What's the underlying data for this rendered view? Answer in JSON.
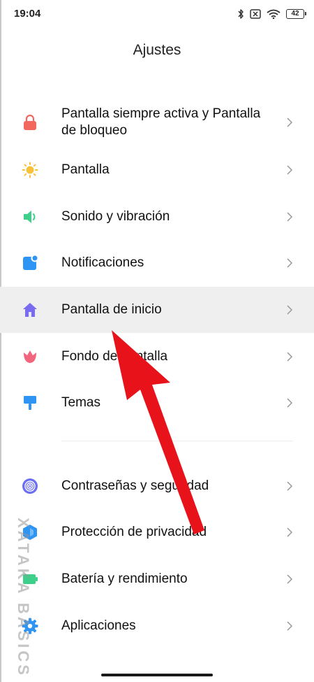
{
  "status_bar": {
    "time": "19:04",
    "battery": "42"
  },
  "header": {
    "title": "Ajustes"
  },
  "settings": {
    "group1": [
      {
        "label": "Pantalla siempre activa y Pantalla de bloqueo",
        "icon": "lock-icon"
      },
      {
        "label": "Pantalla",
        "icon": "sun-icon"
      },
      {
        "label": "Sonido y vibración",
        "icon": "speaker-icon"
      },
      {
        "label": "Notificaciones",
        "icon": "notification-icon"
      },
      {
        "label": "Pantalla de inicio",
        "icon": "home-icon"
      },
      {
        "label": "Fondo de pantalla",
        "icon": "tulip-icon"
      },
      {
        "label": "Temas",
        "icon": "paintbrush-icon"
      }
    ],
    "group2": [
      {
        "label": "Contraseñas y seguridad",
        "icon": "fingerprint-icon"
      },
      {
        "label": "Protección de privacidad",
        "icon": "shield-icon"
      },
      {
        "label": "Batería y rendimiento",
        "icon": "battery-icon"
      },
      {
        "label": "Aplicaciones",
        "icon": "gear-icon"
      }
    ]
  },
  "watermark": "XATAKA BASICS",
  "colors": {
    "lock": "#f2685e",
    "sun": "#f7c23a",
    "speaker": "#3ed08a",
    "notification": "#2f95f5",
    "home": "#7a6cf0",
    "tulip": "#f2667d",
    "paintbrush": "#2f95f5",
    "fingerprint": "#6a6ef0",
    "shield": "#2f95f5",
    "battery": "#3ed08a",
    "gear": "#2f95f5",
    "arrow": "#e8121a"
  }
}
